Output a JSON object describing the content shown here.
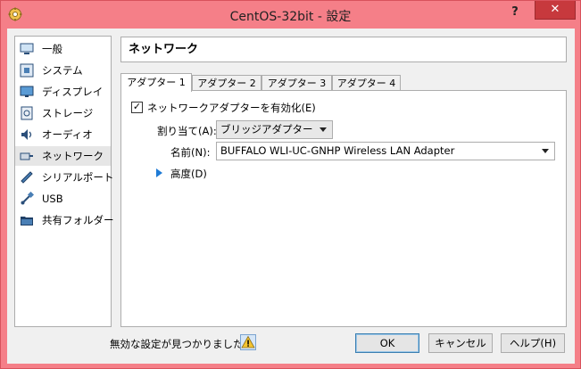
{
  "window": {
    "title": "CentOS-32bit - 設定",
    "help_label": "?",
    "close_label": "✕"
  },
  "sidebar": {
    "items": [
      {
        "label": "一般",
        "icon": "general-icon"
      },
      {
        "label": "システム",
        "icon": "system-icon"
      },
      {
        "label": "ディスプレイ",
        "icon": "display-icon"
      },
      {
        "label": "ストレージ",
        "icon": "storage-icon"
      },
      {
        "label": "オーディオ",
        "icon": "audio-icon"
      },
      {
        "label": "ネットワーク",
        "icon": "network-icon",
        "selected": true
      },
      {
        "label": "シリアルポート",
        "icon": "serial-port-icon"
      },
      {
        "label": "USB",
        "icon": "usb-icon"
      },
      {
        "label": "共有フォルダー",
        "icon": "shared-folder-icon"
      }
    ]
  },
  "page": {
    "title": "ネットワーク"
  },
  "tabs": [
    {
      "label": "アダプター 1",
      "mnemonic": "1",
      "active": true
    },
    {
      "label": "アダプター 2",
      "mnemonic": "2"
    },
    {
      "label": "アダプター 3",
      "mnemonic": "3"
    },
    {
      "label": "アダプター 4",
      "mnemonic": "4"
    }
  ],
  "adapter": {
    "enable_label": "ネットワークアダプターを有効化(E)",
    "enable_checked": true,
    "attached_label": "割り当て(A):",
    "attached_value": "ブリッジアダプター",
    "name_label": "名前(N):",
    "name_value": "BUFFALO WLI-UC-GNHP Wireless LAN Adapter",
    "advanced_label": "高度(D)"
  },
  "footer": {
    "status_text": "無効な設定が見つかりました",
    "ok_label": "OK",
    "cancel_label": "キャンセル",
    "help_label": "ヘルプ(H)"
  }
}
